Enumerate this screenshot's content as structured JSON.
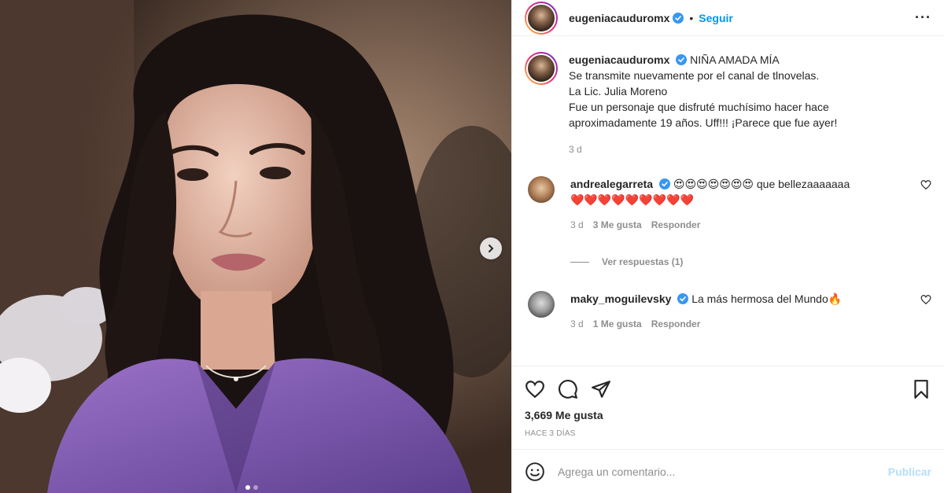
{
  "post": {
    "username": "eugeniacauduromx",
    "follow_label": "Seguir",
    "separator": "•",
    "more_label": "···"
  },
  "caption": {
    "username": "eugeniacauduromx",
    "lines": [
      "NIÑA AMADA MÍA",
      "Se transmite nuevamente por el canal de tlnovelas.",
      "La Lic. Julia Moreno",
      "Fue un personaje que disfruté muchísimo hacer hace",
      "aproximadamente 19 años. Uff!!! ¡Parece que fue ayer!"
    ],
    "time": "3 d"
  },
  "comments": [
    {
      "username": "andrealegarreta",
      "text": "😍😍😍😍😍😍😍 que bellezaaaaaaa",
      "text2": "❤️❤️❤️❤️❤️❤️❤️❤️❤️",
      "time": "3 d",
      "likes": "3 Me gusta",
      "reply": "Responder",
      "view_replies": "Ver respuestas (1)"
    },
    {
      "username": "maky_moguilevsky",
      "text": "La más hermosa del Mundo🔥",
      "time": "3 d",
      "likes": "1 Me gusta",
      "reply": "Responder"
    }
  ],
  "likes_count": "3,669 Me gusta",
  "posted_ago": "HACE 3 DÍAS",
  "add_comment": {
    "placeholder": "Agrega un comentario...",
    "publish_label": "Publicar"
  },
  "carousel": {
    "total": 2,
    "current": 1
  },
  "colors": {
    "link": "#0095f6",
    "muted": "#8e8e8e",
    "publish_disabled": "#b2dffc",
    "verified": "#3897f0"
  }
}
